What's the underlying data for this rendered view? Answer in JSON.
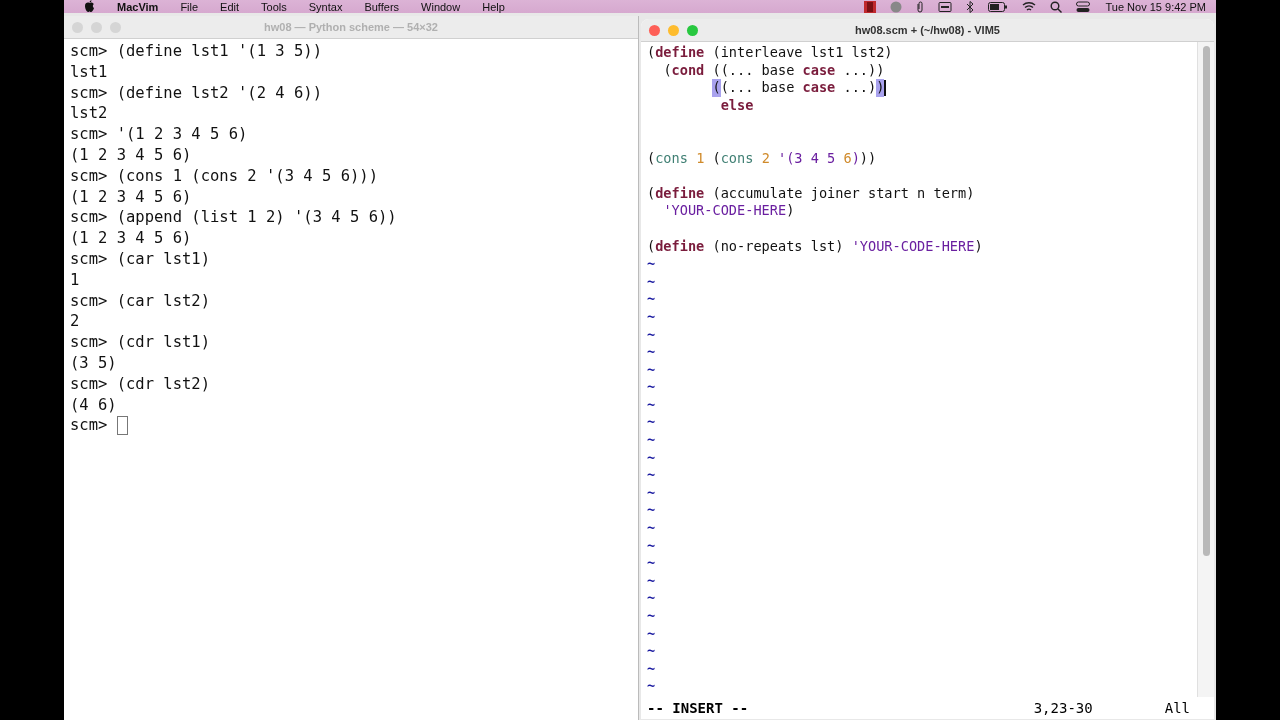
{
  "menu_bar": {
    "app": "MacVim",
    "menus": [
      "File",
      "Edit",
      "Tools",
      "Syntax",
      "Buffers",
      "Window",
      "Help"
    ],
    "clock": "Tue Nov 15  9:42 PM"
  },
  "terminal": {
    "title": "hw08 — Python scheme — 54×32",
    "lines": [
      {
        "prompt": "scm> ",
        "text": "(define lst1 '(1 3 5))"
      },
      {
        "text": "lst1"
      },
      {
        "prompt": "scm> ",
        "text": "(define lst2 '(2 4 6))"
      },
      {
        "text": "lst2"
      },
      {
        "prompt": "scm> ",
        "text": "'(1 2 3 4 5 6)"
      },
      {
        "text": "(1 2 3 4 5 6)"
      },
      {
        "prompt": "scm> ",
        "text": "(cons 1 (cons 2 '(3 4 5 6)))"
      },
      {
        "text": "(1 2 3 4 5 6)"
      },
      {
        "prompt": "scm> ",
        "text": "(append (list 1 2) '(3 4 5 6))"
      },
      {
        "text": "(1 2 3 4 5 6)"
      },
      {
        "prompt": "scm> ",
        "text": "(car lst1)"
      },
      {
        "text": "1"
      },
      {
        "prompt": "scm> ",
        "text": "(car lst2)"
      },
      {
        "text": "2"
      },
      {
        "prompt": "scm> ",
        "text": "(cdr lst1)"
      },
      {
        "text": "(3 5)"
      },
      {
        "prompt": "scm> ",
        "text": "(cdr lst2)"
      },
      {
        "text": "(4 6)"
      },
      {
        "prompt": "scm> ",
        "cursor": true
      }
    ]
  },
  "editor": {
    "title": "hw08.scm + (~/hw08) - VIM5",
    "lines": [
      {
        "tokens": [
          {
            "text": "(",
            "kind": "plain"
          },
          {
            "text": "define",
            "kind": "keyword"
          },
          {
            "text": " (interleave lst1 lst2)",
            "kind": "plain"
          }
        ]
      },
      {
        "tokens": [
          {
            "text": "  (",
            "kind": "plain"
          },
          {
            "text": "cond",
            "kind": "keyword"
          },
          {
            "text": " ((... base ",
            "kind": "plain"
          },
          {
            "text": "case",
            "kind": "keyword"
          },
          {
            "text": " ...))",
            "kind": "plain"
          }
        ]
      },
      {
        "tokens": [
          {
            "text": "        (",
            "kind": "match"
          },
          {
            "text": "(... base ",
            "kind": "plain"
          },
          {
            "text": "case",
            "kind": "keyword"
          },
          {
            "text": " ...)",
            "kind": "plain"
          },
          {
            "text": ")",
            "kind": "match",
            "cursor": true
          }
        ]
      },
      {
        "tokens": [
          {
            "text": "         else",
            "kind": "keyword"
          }
        ]
      },
      {
        "kind": "blank"
      },
      {
        "kind": "blank"
      },
      {
        "tokens": [
          {
            "text": "(",
            "kind": "plain"
          },
          {
            "text": "cons",
            "kind": "builtin"
          },
          {
            "text": " 1",
            "kind": "number"
          },
          {
            "text": " (",
            "kind": "plain"
          },
          {
            "text": "cons",
            "kind": "builtin"
          },
          {
            "text": " 2",
            "kind": "number"
          },
          {
            "text": " '(3 4 5 ",
            "kind": "quote"
          },
          {
            "text": "6",
            "kind": "number"
          },
          {
            "text": ")",
            "kind": "quote"
          },
          {
            "text": "))",
            "kind": "plain"
          }
        ]
      },
      {
        "kind": "blank"
      },
      {
        "tokens": [
          {
            "text": "(",
            "kind": "plain"
          },
          {
            "text": "define",
            "kind": "keyword"
          },
          {
            "text": " (accumulate joiner start n term)",
            "kind": "plain"
          }
        ]
      },
      {
        "tokens": [
          {
            "text": "  'YOUR-CODE-HERE",
            "kind": "quote"
          },
          {
            "text": ")",
            "kind": "plain"
          }
        ]
      },
      {
        "kind": "blank"
      },
      {
        "tokens": [
          {
            "text": "(",
            "kind": "plain"
          },
          {
            "text": "define",
            "kind": "keyword"
          },
          {
            "text": " (no-repeats lst) ",
            "kind": "plain"
          },
          {
            "text": "'YOUR-CODE-HERE",
            "kind": "quote"
          },
          {
            "text": ")",
            "kind": "plain"
          }
        ]
      }
    ],
    "filler": [
      "~",
      "~",
      "~",
      "~",
      "~",
      "~",
      "~",
      "~",
      "~",
      "~",
      "~",
      "~",
      "~",
      "~",
      "~",
      "~",
      "~",
      "~",
      "~",
      "~",
      "~",
      "~",
      "~",
      "~",
      "~"
    ],
    "mode": "-- INSERT --",
    "position": "3,23-30",
    "scroll": "All"
  }
}
